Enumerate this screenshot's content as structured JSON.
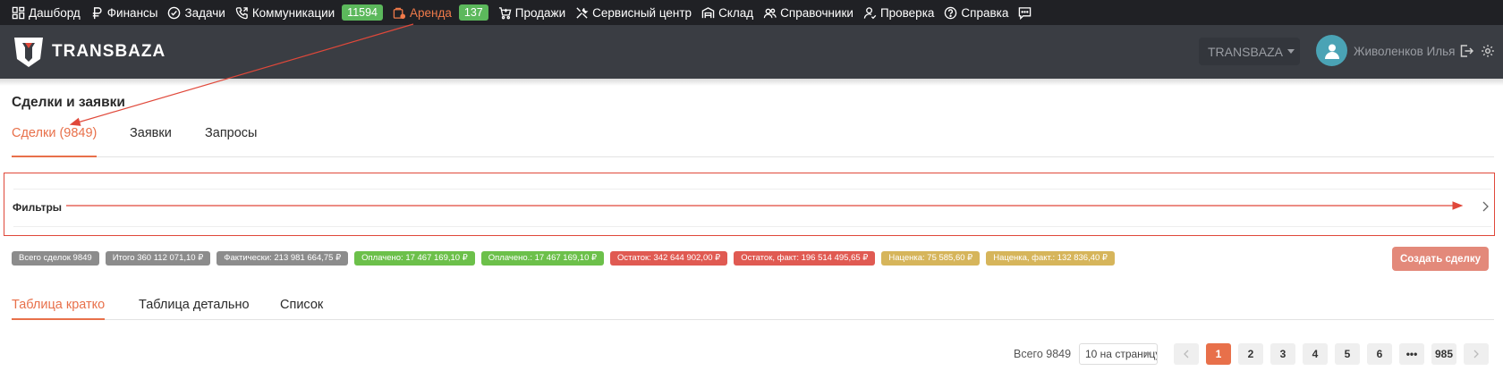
{
  "topnav": {
    "items": [
      {
        "label": "Дашборд",
        "icon": "dashboard-icon"
      },
      {
        "label": "Финансы",
        "icon": "ruble-icon"
      },
      {
        "label": "Задачи",
        "icon": "check-circle-icon"
      },
      {
        "label": "Коммуникации",
        "icon": "phone-icon",
        "badge": "11594"
      },
      {
        "label": "Аренда",
        "icon": "rent-icon",
        "badge": "137",
        "active": true
      },
      {
        "label": "Продажи",
        "icon": "cart-icon"
      },
      {
        "label": "Сервисный центр",
        "icon": "tools-icon"
      },
      {
        "label": "Склад",
        "icon": "warehouse-icon"
      },
      {
        "label": "Справочники",
        "icon": "users-icon"
      },
      {
        "label": "Проверка",
        "icon": "user-check-icon"
      },
      {
        "label": "Справка",
        "icon": "help-icon"
      }
    ],
    "badge_color": "#5cb85c",
    "active_color": "#f07a4a"
  },
  "header": {
    "logo_text": "TRANSBAZA",
    "company": "TRANSBAZA",
    "user_name": "Живоленков Илья"
  },
  "page": {
    "title": "Сделки и заявки",
    "tabs": [
      "Сделки (9849)",
      "Заявки",
      "Запросы"
    ],
    "filters_label": "Фильтры"
  },
  "badges": [
    {
      "text": "Всего сделок 9849",
      "color": "#8c8c8c"
    },
    {
      "text": "Итого 360 112 071,10 ₽",
      "color": "#8c8c8c"
    },
    {
      "text": "Фактически: 213 981 664,75 ₽",
      "color": "#8c8c8c"
    },
    {
      "text": "Оплачено: 17 467 169,10 ₽",
      "color": "#6cc04a"
    },
    {
      "text": "Оплачено.: 17 467 169,10 ₽",
      "color": "#6cc04a"
    },
    {
      "text": "Остаток: 342 644 902,00 ₽",
      "color": "#e05a52"
    },
    {
      "text": "Остаток, факт: 196 514 495,65 ₽",
      "color": "#e05a52"
    },
    {
      "text": "Наценка: 75 585,60 ₽",
      "color": "#d6b55b"
    },
    {
      "text": "Наценка, факт.: 132 836,40 ₽",
      "color": "#d6b55b"
    }
  ],
  "create_button": "Создать сделку",
  "view_tabs": [
    "Таблица кратко",
    "Таблица детально",
    "Список"
  ],
  "pagination": {
    "total": "Всего 9849",
    "per_page": "10 на страницу",
    "pages": [
      "1",
      "2",
      "3",
      "4",
      "5",
      "6",
      "•••",
      "985"
    ],
    "current": "1"
  },
  "accent_color": "#e8704a",
  "annotation_color": "#e0483a"
}
